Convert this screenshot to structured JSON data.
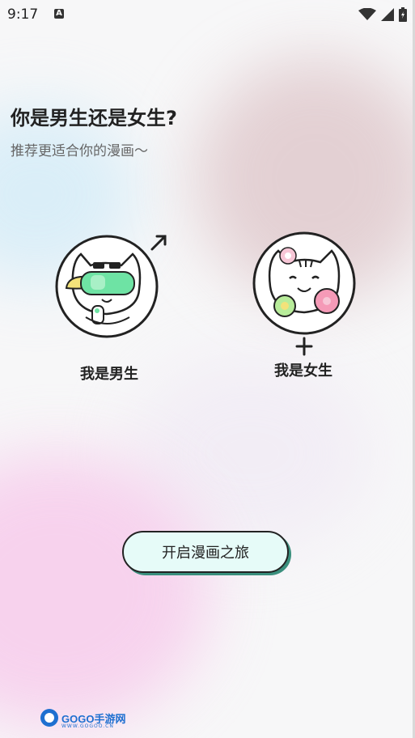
{
  "status_bar": {
    "time": "9:17",
    "notification_icon": "a-icon",
    "icons": [
      "wifi-icon",
      "signal-icon",
      "battery-icon"
    ]
  },
  "header": {
    "title": "你是男生还是女生?",
    "subtitle": "推荐更适合你的漫画～"
  },
  "choices": {
    "male": {
      "label": "我是男生",
      "symbol": "male-symbol-icon"
    },
    "female": {
      "label": "我是女生",
      "symbol": "female-symbol-icon"
    }
  },
  "cta": {
    "label": "开启漫画之旅"
  },
  "watermark": {
    "brand": "GOGO手游网",
    "url": "WWW.GOGOO.CN"
  },
  "colors": {
    "cta_fill": "#e6fbf8",
    "cta_shadow": "#3a8f7d",
    "accent_green": "#6ee3a4",
    "accent_pink": "#f59ab7",
    "text_dark": "#222222",
    "text_muted": "#666666"
  }
}
